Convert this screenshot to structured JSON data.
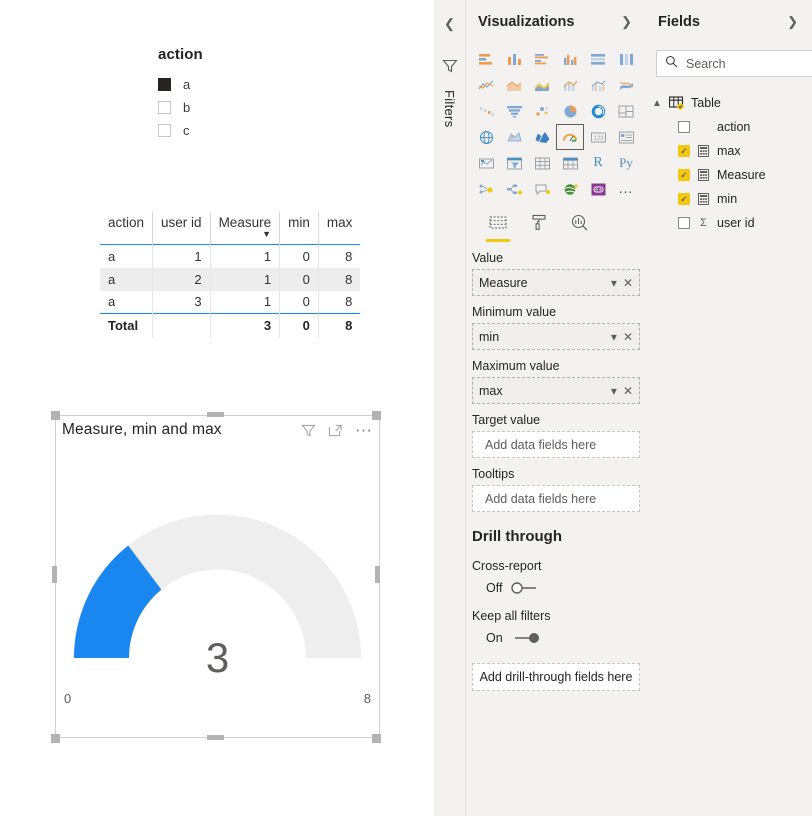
{
  "canvas": {
    "slicer": {
      "title": "action",
      "items": [
        {
          "label": "a",
          "checked": true
        },
        {
          "label": "b",
          "checked": false
        },
        {
          "label": "c",
          "checked": false
        }
      ]
    },
    "matrix": {
      "columns": [
        "action",
        "user id",
        "Measure",
        "min",
        "max"
      ],
      "sorted_column": "Measure",
      "sort_caret": "▼",
      "rows": [
        [
          "a",
          "1",
          "1",
          "0",
          "8"
        ],
        [
          "a",
          "2",
          "1",
          "0",
          "8"
        ],
        [
          "a",
          "3",
          "1",
          "0",
          "8"
        ]
      ],
      "total_row": [
        "Total",
        "",
        "3",
        "0",
        "8"
      ]
    },
    "gauge": {
      "title": "Measure, min and max",
      "value": "3",
      "min_label": "0",
      "max_label": "8",
      "min": 0,
      "max": 8,
      "current": 3,
      "arc_color": "#1a86ef",
      "track_color": "#eeeeee",
      "header_icons": [
        "filter-icon",
        "focus-mode-icon",
        "more-options-icon"
      ]
    }
  },
  "filters_rail": {
    "label": "Filters",
    "collapse_icon": "chevron-left-icon",
    "funnel_icon": "filter-icon"
  },
  "visualizations": {
    "title": "Visualizations",
    "expand_icon": "chevron-right-icon",
    "gallery": {
      "selected": "gauge",
      "more_label": "…",
      "icons": [
        "stacked-bar-chart",
        "stacked-column-chart",
        "clustered-bar-chart",
        "clustered-column-chart",
        "100-stacked-bar-chart",
        "100-stacked-column-chart",
        "line-chart",
        "area-chart",
        "stacked-area-chart",
        "line-stacked-column-chart",
        "line-clustered-column-chart",
        "ribbon-chart",
        "waterfall-chart",
        "funnel-chart",
        "scatter-chart",
        "pie-chart",
        "donut-chart",
        "treemap",
        "map",
        "filled-map",
        "shape-map",
        "gauge",
        "card",
        "multi-row-card",
        "kpi",
        "slicer",
        "table",
        "matrix",
        "r-script-visual",
        "python-visual",
        "key-influencers",
        "decomposition-tree",
        "qna-visual",
        "smart-narrative",
        "custom-visual",
        "more-visuals"
      ]
    },
    "tabs": [
      {
        "name": "fields-tab",
        "icon": "fields-icon",
        "active": true
      },
      {
        "name": "format-tab",
        "icon": "paint-roller-icon",
        "active": false
      },
      {
        "name": "analytics-tab",
        "icon": "magnifier-chart-icon",
        "active": false
      }
    ],
    "wells": [
      {
        "label": "Value",
        "value": "Measure",
        "filled": true
      },
      {
        "label": "Minimum value",
        "value": "min",
        "filled": true
      },
      {
        "label": "Maximum value",
        "value": "max",
        "filled": true
      },
      {
        "label": "Target value",
        "value": "Add data fields here",
        "filled": false
      },
      {
        "label": "Tooltips",
        "value": "Add data fields here",
        "filled": false
      }
    ],
    "drill_through": {
      "heading": "Drill through",
      "cross_report": {
        "label": "Cross-report",
        "state": "Off",
        "on": false
      },
      "keep_all_filters": {
        "label": "Keep all filters",
        "state": "On",
        "on": true
      },
      "add_button": "Add drill-through fields here"
    }
  },
  "fields": {
    "title": "Fields",
    "expand_icon": "chevron-right-icon",
    "search_placeholder": "Search",
    "search_value": "",
    "table": {
      "name": "Table",
      "expanded": true,
      "icon": "table-icon"
    },
    "items": [
      {
        "label": "action",
        "checked": false,
        "icon": "none"
      },
      {
        "label": "max",
        "checked": true,
        "icon": "measure-icon"
      },
      {
        "label": "Measure",
        "checked": true,
        "icon": "measure-icon"
      },
      {
        "label": "min",
        "checked": true,
        "icon": "measure-icon"
      },
      {
        "label": "user id",
        "checked": false,
        "icon": "sigma-icon"
      }
    ]
  }
}
